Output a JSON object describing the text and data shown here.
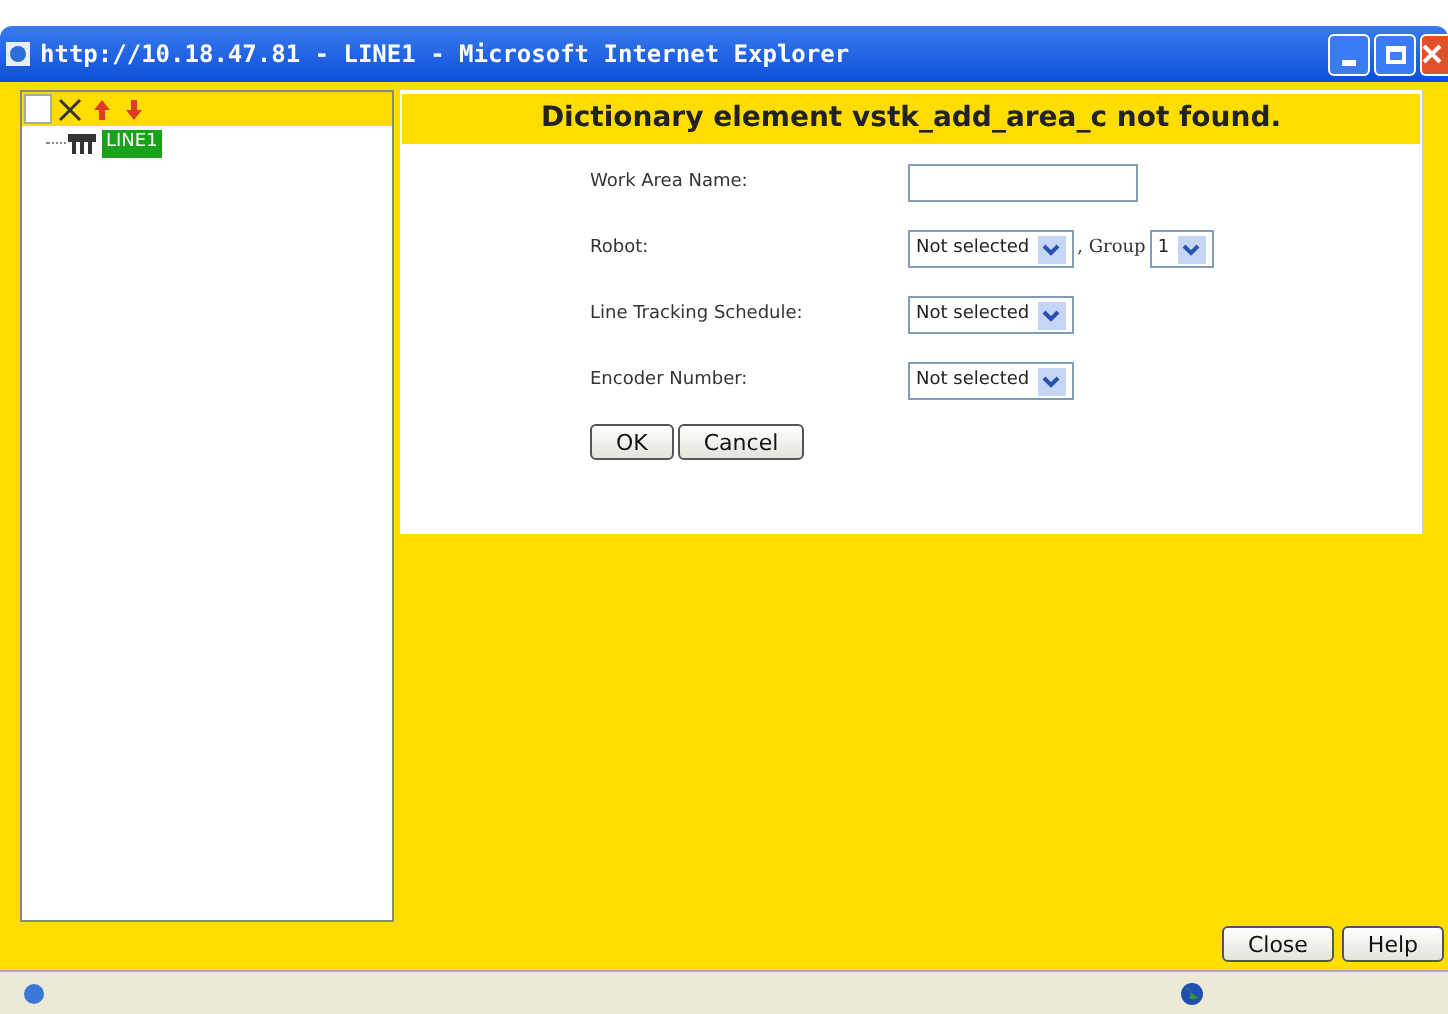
{
  "window": {
    "title": "http://10.18.47.81 - LINE1 - Microsoft Internet Explorer"
  },
  "tree": {
    "items": [
      {
        "label": "LINE1",
        "selected": true
      }
    ]
  },
  "header": "Dictionary element vstk_add_area_c not found.",
  "form": {
    "fields": [
      {
        "kind": "text",
        "label": "Work Area Name:"
      },
      {
        "kind": "select",
        "label": "Robot:",
        "value": "Not selected",
        "extra_label": ", Group",
        "extra_value": "1"
      },
      {
        "kind": "select",
        "label": "Line Tracking Schedule:",
        "value": "Not selected"
      },
      {
        "kind": "select",
        "label": "Encoder Number:",
        "value": "Not selected"
      }
    ],
    "buttons": [
      "OK",
      "Cancel"
    ]
  },
  "footer_buttons": [
    "Close",
    "Help"
  ]
}
